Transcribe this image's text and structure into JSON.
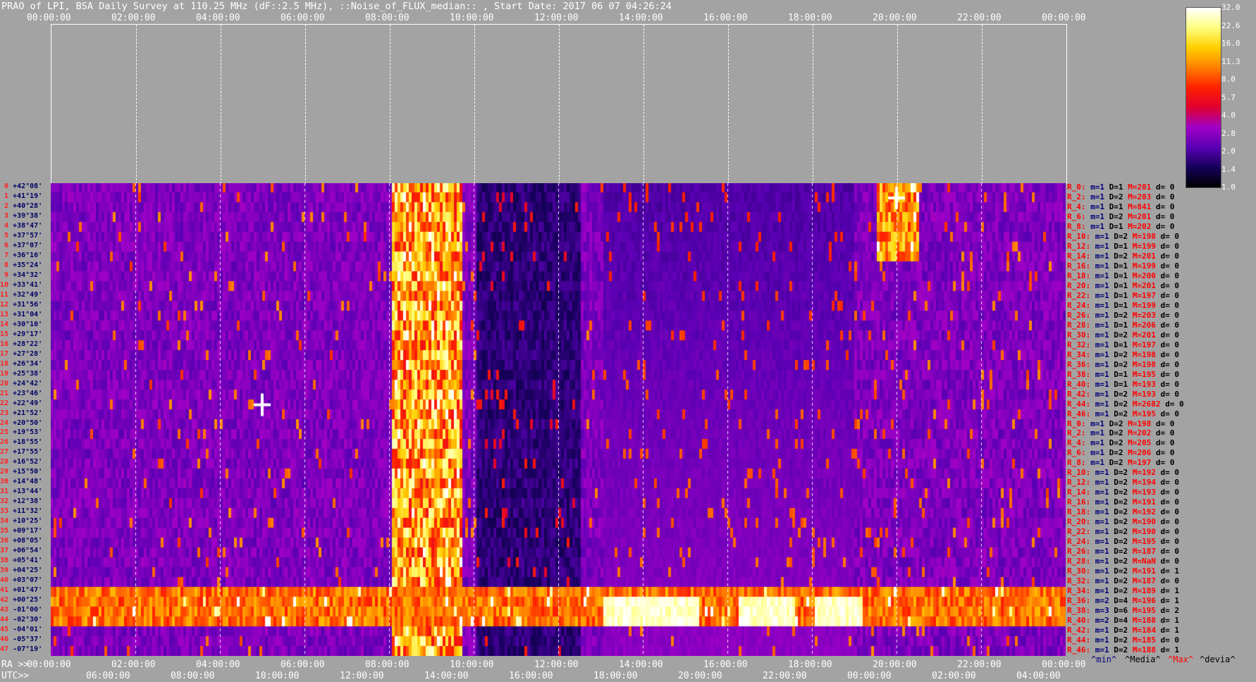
{
  "title": "PRAO of LPI, BSA Daily Survey at 110.25 MHz (dF::2.5 MHz), ::Noise_of_FLUX_median:: , Start Date: 2017 06 07 04:26:24",
  "top_axis": {
    "ticks": [
      "00:00:00",
      "02:00:00",
      "04:00:00",
      "06:00:00",
      "08:00:00",
      "10:00:00",
      "12:00:00",
      "14:00:00",
      "16:00:00",
      "18:00:00",
      "20:00:00",
      "22:00:00",
      "00:00:00"
    ]
  },
  "bottom_axis": {
    "ra_prefix": "RA >>",
    "utc_prefix": "UTC>>",
    "ra_ticks": [
      "00:00:00",
      "02:00:00",
      "04:00:00",
      "06:00:00",
      "08:00:00",
      "10:00:00",
      "12:00:00",
      "14:00:00",
      "16:00:00",
      "18:00:00",
      "20:00:00",
      "22:00:00",
      "00:00:00"
    ],
    "utc_ticks": [
      "06:00:00",
      "08:00:00",
      "10:00:00",
      "12:00:00",
      "14:00:00",
      "16:00:00",
      "18:00:00",
      "20:00:00",
      "22:00:00",
      "00:00:00",
      "02:00:00",
      "04:00:00"
    ]
  },
  "bottom_legend": {
    "min": "^min^",
    "median": "^Media^",
    "max": "^Max^",
    "devia": "^devia^"
  },
  "colorbar": {
    "ticks": [
      "32.0",
      "22.6",
      "16.0",
      "11.3",
      "8.0",
      "5.7",
      "4.0",
      "2.8",
      "2.0",
      "1.4",
      "1.0"
    ]
  },
  "declinations": [
    "+42°08'",
    "+41°19'",
    "+40°28'",
    "+39°38'",
    "+38°47'",
    "+37°57'",
    "+37°07'",
    "+36°16'",
    "+35°24'",
    "+34°32'",
    "+33°41'",
    "+32°49'",
    "+31°56'",
    "+31°04'",
    "+30°10'",
    "+29°17'",
    "+28°22'",
    "+27°28'",
    "+26°34'",
    "+25°38'",
    "+24°42'",
    "+23°46'",
    "+22°49'",
    "+21°52'",
    "+20°50'",
    "+19°53'",
    "+18°55'",
    "+17°55'",
    "+16°52'",
    "+15°50'",
    "+14°48'",
    "+13°44'",
    "+12°38'",
    "+11°32'",
    "+10°25'",
    "+09°17'",
    "+08°05'",
    "+06°54'",
    "+05°41'",
    "+04°25'",
    "+03°07'",
    "+01°47'",
    "+00°25'",
    "-01°00'",
    "-02°30'",
    "-04°01'",
    "-05°37'",
    "-07°19'"
  ],
  "row_legend": [
    {
      "r": "R_0:",
      "m": "m=1",
      "D": "D=1",
      "M": "M=201",
      "d": "d= 0"
    },
    {
      "r": "R_2:",
      "m": "m=1",
      "D": "D=2",
      "M": "M=203",
      "d": "d= 0"
    },
    {
      "r": "R_4:",
      "m": "m=1",
      "D": "D=1",
      "M": "M=841",
      "d": "d= 0"
    },
    {
      "r": "R_6:",
      "m": "m=1",
      "D": "D=2",
      "M": "M=201",
      "d": "d= 0"
    },
    {
      "r": "R_8:",
      "m": "m=1",
      "D": "D=1",
      "M": "M=202",
      "d": "d= 0"
    },
    {
      "r": "R_10:",
      "m": "m=1",
      "D": "D=2",
      "M": "M=198",
      "d": "d= 0"
    },
    {
      "r": "R_12:",
      "m": "m=1",
      "D": "D=1",
      "M": "M=199",
      "d": "d= 0"
    },
    {
      "r": "R_14:",
      "m": "m=1",
      "D": "D=2",
      "M": "M=201",
      "d": "d= 0"
    },
    {
      "r": "R_16:",
      "m": "m=1",
      "D": "D=1",
      "M": "M=199",
      "d": "d= 0"
    },
    {
      "r": "R_18:",
      "m": "m=1",
      "D": "D=1",
      "M": "M=200",
      "d": "d= 0"
    },
    {
      "r": "R_20:",
      "m": "m=1",
      "D": "D=1",
      "M": "M=201",
      "d": "d= 0"
    },
    {
      "r": "R_22:",
      "m": "m=1",
      "D": "D=1",
      "M": "M=197",
      "d": "d= 0"
    },
    {
      "r": "R_24:",
      "m": "m=1",
      "D": "D=1",
      "M": "M=199",
      "d": "d= 0"
    },
    {
      "r": "R_26:",
      "m": "m=1",
      "D": "D=2",
      "M": "M=203",
      "d": "d= 0"
    },
    {
      "r": "R_28:",
      "m": "m=1",
      "D": "D=1",
      "M": "M=206",
      "d": "d= 0"
    },
    {
      "r": "R_30:",
      "m": "m=1",
      "D": "D=2",
      "M": "M=201",
      "d": "d= 0"
    },
    {
      "r": "R_32:",
      "m": "m=1",
      "D": "D=1",
      "M": "M=197",
      "d": "d= 0"
    },
    {
      "r": "R_34:",
      "m": "m=1",
      "D": "D=2",
      "M": "M=198",
      "d": "d= 0"
    },
    {
      "r": "R_36:",
      "m": "m=1",
      "D": "D=2",
      "M": "M=198",
      "d": "d= 0"
    },
    {
      "r": "R_38:",
      "m": "m=1",
      "D": "D=1",
      "M": "M=195",
      "d": "d= 0"
    },
    {
      "r": "R_40:",
      "m": "m=1",
      "D": "D=1",
      "M": "M=193",
      "d": "d= 0"
    },
    {
      "r": "R_42:",
      "m": "m=1",
      "D": "D=2",
      "M": "M=193",
      "d": "d= 0"
    },
    {
      "r": "R_44:",
      "m": "m=1",
      "D": "D=2",
      "M": "M=2682",
      "d": "d= 0"
    },
    {
      "r": "R_46:",
      "m": "m=1",
      "D": "D=2",
      "M": "M=195",
      "d": "d= 0"
    },
    {
      "r": "R_0:",
      "m": "m=1",
      "D": "D=2",
      "M": "M=198",
      "d": "d= 0"
    },
    {
      "r": "R_2:",
      "m": "m=1",
      "D": "D=2",
      "M": "M=202",
      "d": "d= 0"
    },
    {
      "r": "R_4:",
      "m": "m=1",
      "D": "D=2",
      "M": "M=205",
      "d": "d= 0"
    },
    {
      "r": "R_6:",
      "m": "m=1",
      "D": "D=2",
      "M": "M=206",
      "d": "d= 0"
    },
    {
      "r": "R_8:",
      "m": "m=1",
      "D": "D=2",
      "M": "M=197",
      "d": "d= 0"
    },
    {
      "r": "R_10:",
      "m": "m=1",
      "D": "D=2",
      "M": "M=192",
      "d": "d= 0"
    },
    {
      "r": "R_12:",
      "m": "m=1",
      "D": "D=2",
      "M": "M=194",
      "d": "d= 0"
    },
    {
      "r": "R_14:",
      "m": "m=1",
      "D": "D=2",
      "M": "M=193",
      "d": "d= 0"
    },
    {
      "r": "R_16:",
      "m": "m=1",
      "D": "D=2",
      "M": "M=191",
      "d": "d= 0"
    },
    {
      "r": "R_18:",
      "m": "m=1",
      "D": "D=2",
      "M": "M=192",
      "d": "d= 0"
    },
    {
      "r": "R_20:",
      "m": "m=1",
      "D": "D=2",
      "M": "M=190",
      "d": "d= 0"
    },
    {
      "r": "R_22:",
      "m": "m=1",
      "D": "D=2",
      "M": "M=190",
      "d": "d= 0"
    },
    {
      "r": "R_24:",
      "m": "m=1",
      "D": "D=2",
      "M": "M=195",
      "d": "d= 0"
    },
    {
      "r": "R_26:",
      "m": "m=1",
      "D": "D=2",
      "M": "M=187",
      "d": "d= 0"
    },
    {
      "r": "R_28:",
      "m": "m=1",
      "D": "D=2",
      "M": "M=NaN",
      "d": "d= 0"
    },
    {
      "r": "R_30:",
      "m": "m=1",
      "D": "D=2",
      "M": "M=191",
      "d": "d= 1"
    },
    {
      "r": "R_32:",
      "m": "m=1",
      "D": "D=2",
      "M": "M=187",
      "d": "d= 0"
    },
    {
      "r": "R_34:",
      "m": "m=1",
      "D": "D=2",
      "M": "M=189",
      "d": "d= 1"
    },
    {
      "r": "R_36:",
      "m": "m=2",
      "D": "D=4",
      "M": "M=196",
      "d": "d= 1"
    },
    {
      "r": "R_38:",
      "m": "m=3",
      "D": "D=6",
      "M": "M=195",
      "d": "d= 2"
    },
    {
      "r": "R_40:",
      "m": "m=2",
      "D": "D=4",
      "M": "M=188",
      "d": "d= 1"
    },
    {
      "r": "R_42:",
      "m": "m=1",
      "D": "D=2",
      "M": "M=184",
      "d": "d= 1"
    },
    {
      "r": "R_44:",
      "m": "m=1",
      "D": "D=2",
      "M": "M=185",
      "d": "d= 0"
    },
    {
      "r": "R_46:",
      "m": "m=1",
      "D": "D=2",
      "M": "M=188",
      "d": "d= 1"
    }
  ],
  "chart_data": {
    "type": "heatmap",
    "title": "PRAO of LPI, BSA Daily Survey at 110.25 MHz (dF::2.5 MHz), ::Noise_of_FLUX_median:: , Start Date: 2017 06 07 04:26:24",
    "x_axis_ticks_RA": [
      "00:00:00",
      "02:00:00",
      "04:00:00",
      "06:00:00",
      "08:00:00",
      "10:00:00",
      "12:00:00",
      "14:00:00",
      "16:00:00",
      "18:00:00",
      "20:00:00",
      "22:00:00",
      "00:00:00"
    ],
    "x_axis_ticks_UTC": [
      "06:00:00",
      "08:00:00",
      "10:00:00",
      "12:00:00",
      "14:00:00",
      "16:00:00",
      "18:00:00",
      "20:00:00",
      "22:00:00",
      "00:00:00",
      "02:00:00",
      "04:00:00"
    ],
    "y_axis": "declination",
    "colorscale": [
      "#000000",
      "#16005a",
      "#5a00b4",
      "#a000c8",
      "#e00030",
      "#ff2000",
      "#ff8000",
      "#ffd000",
      "#ffff80",
      "#ffffff"
    ],
    "colorbar_ticks": [
      32.0,
      22.6,
      16.0,
      11.3,
      8.0,
      5.7,
      4.0,
      2.8,
      2.0,
      1.4,
      1.0
    ],
    "colorbar_scale": "log",
    "bright_features": [
      {
        "ra_hours": 8.5,
        "dec_rows": [
          0,
          47
        ],
        "desc_value": "high"
      },
      {
        "ra_hours": 20.0,
        "dec_row": 1,
        "value": 32.0
      },
      {
        "ra_hours": 5.0,
        "dec_row": 22,
        "value": 32.0
      },
      {
        "ra_hours": 14.0,
        "dec_rows": [
          42,
          44
        ],
        "value": 32.0
      }
    ]
  }
}
